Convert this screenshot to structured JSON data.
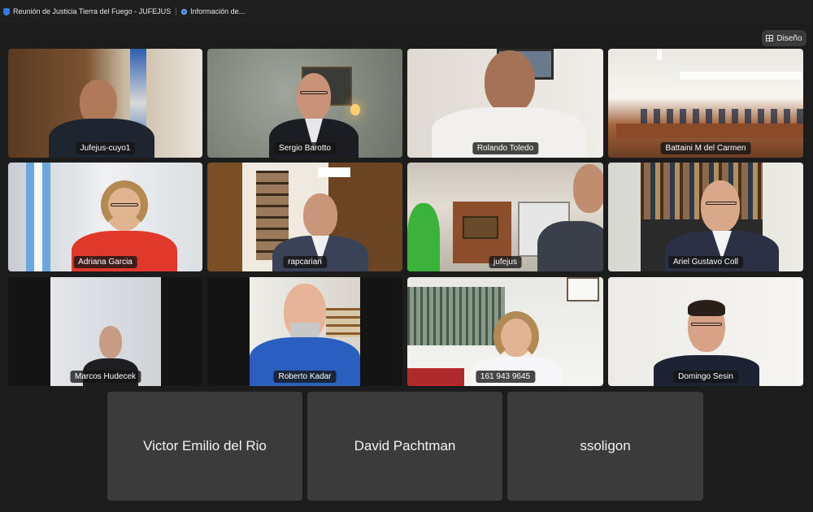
{
  "window": {
    "tabs": [
      {
        "label": "Reunión de Justicia Tierra del Fuego - JUFEJUS"
      },
      {
        "label": "Información de..."
      }
    ]
  },
  "layout_button": {
    "label": "Diseño",
    "icon": "grid-icon"
  },
  "participants": [
    {
      "name": "Jufejus-cuyo1"
    },
    {
      "name": "Sergio Barotto"
    },
    {
      "name": "Rolando Toledo"
    },
    {
      "name": "Battaini M del Carmen"
    },
    {
      "name": "Adriana Garcia"
    },
    {
      "name": "rapcarian"
    },
    {
      "name": "jufejus"
    },
    {
      "name": "Ariel Gustavo Coll"
    },
    {
      "name": "Marcos Hudecek"
    },
    {
      "name": "Roberto Kadar"
    },
    {
      "name": "161 943 9645"
    },
    {
      "name": "Domingo Sesin"
    }
  ],
  "audio_only_participants": [
    {
      "name": "Victor Emilio del Rio"
    },
    {
      "name": "David Pachtman"
    },
    {
      "name": "ssoligon"
    }
  ],
  "colors": {
    "background": "#1c1c1c",
    "name_tile": "#3b3b3b",
    "accent": "#2f7de1"
  }
}
